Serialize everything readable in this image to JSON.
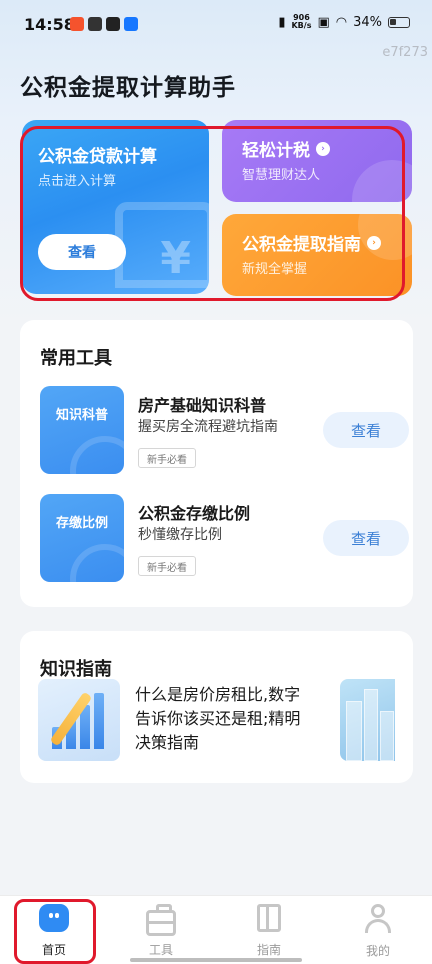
{
  "status_bar": {
    "time": "14:58",
    "net_speed_value": "906",
    "net_speed_unit": "KB/s",
    "battery": "34%"
  },
  "tagline": "e7f273",
  "page": {
    "title": "公积金提取计算助手"
  },
  "feature_cards": {
    "loan": {
      "title": "公积金贷款计算",
      "subtitle": "点击进入计算",
      "button": "查看",
      "symbol": "¥"
    },
    "tax": {
      "title": "轻松计税",
      "subtitle": "智慧理财达人"
    },
    "guide": {
      "title": "公积金提取指南",
      "subtitle": "新规全掌握"
    }
  },
  "tools": {
    "heading": "常用工具",
    "items": [
      {
        "thumb_label": "知识科普",
        "title": "房产基础知识科普",
        "desc": "握买房全流程避坑指南",
        "tag": "新手必看",
        "button": "查看"
      },
      {
        "thumb_label": "存缴比例",
        "title": "公积金存缴比例",
        "desc": "秒懂缴存比例",
        "tag": "新手必看",
        "button": "查看"
      }
    ]
  },
  "knowledge": {
    "heading": "知识指南",
    "article": "什么是房价房租比,数字告诉你该买还是租;精明决策指南"
  },
  "tab_bar": {
    "items": [
      {
        "label": "首页",
        "icon": "home-icon",
        "active": true
      },
      {
        "label": "工具",
        "icon": "toolbox-icon",
        "active": false
      },
      {
        "label": "指南",
        "icon": "book-icon",
        "active": false
      },
      {
        "label": "我的",
        "icon": "user-icon",
        "active": false
      }
    ]
  },
  "colors": {
    "accent_blue": "#2b8ff1",
    "purple_card": "#9a6ff2",
    "orange_card": "#fb9226",
    "highlight_red": "#e0192c"
  }
}
